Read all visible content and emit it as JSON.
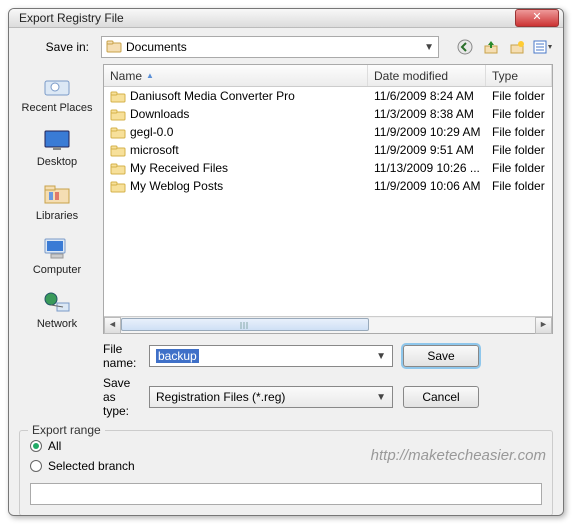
{
  "title": "Export Registry File",
  "toolbar": {
    "save_in_label": "Save in:",
    "save_in_value": "Documents",
    "icons": {
      "back": "back-icon",
      "up": "up-one-level-icon",
      "newfolder": "new-folder-icon",
      "views": "views-icon"
    }
  },
  "places": [
    {
      "label": "Recent Places",
      "icon": "recent"
    },
    {
      "label": "Desktop",
      "icon": "desktop"
    },
    {
      "label": "Libraries",
      "icon": "libraries"
    },
    {
      "label": "Computer",
      "icon": "computer"
    },
    {
      "label": "Network",
      "icon": "network"
    }
  ],
  "columns": {
    "name": "Name",
    "date": "Date modified",
    "type": "Type"
  },
  "files": [
    {
      "name": "Daniusoft Media Converter Pro",
      "date": "11/6/2009 8:24 AM",
      "type": "File folder"
    },
    {
      "name": "Downloads",
      "date": "11/3/2009 8:38 AM",
      "type": "File folder"
    },
    {
      "name": "gegl-0.0",
      "date": "11/9/2009 10:29 AM",
      "type": "File folder"
    },
    {
      "name": "microsoft",
      "date": "11/9/2009 9:51 AM",
      "type": "File folder"
    },
    {
      "name": "My Received Files",
      "date": "11/13/2009 10:26 ...",
      "type": "File folder"
    },
    {
      "name": "My Weblog Posts",
      "date": "11/9/2009 10:06 AM",
      "type": "File folder"
    }
  ],
  "form": {
    "filename_label": "File name:",
    "filename_value": "backup",
    "saveas_label": "Save as type:",
    "saveas_value": "Registration Files (*.reg)",
    "save_btn": "Save",
    "cancel_btn": "Cancel"
  },
  "export_range": {
    "legend": "Export range",
    "all": "All",
    "selected_branch": "Selected branch",
    "selected": "all",
    "branch_value": ""
  },
  "watermark": "http://maketecheasier.com"
}
